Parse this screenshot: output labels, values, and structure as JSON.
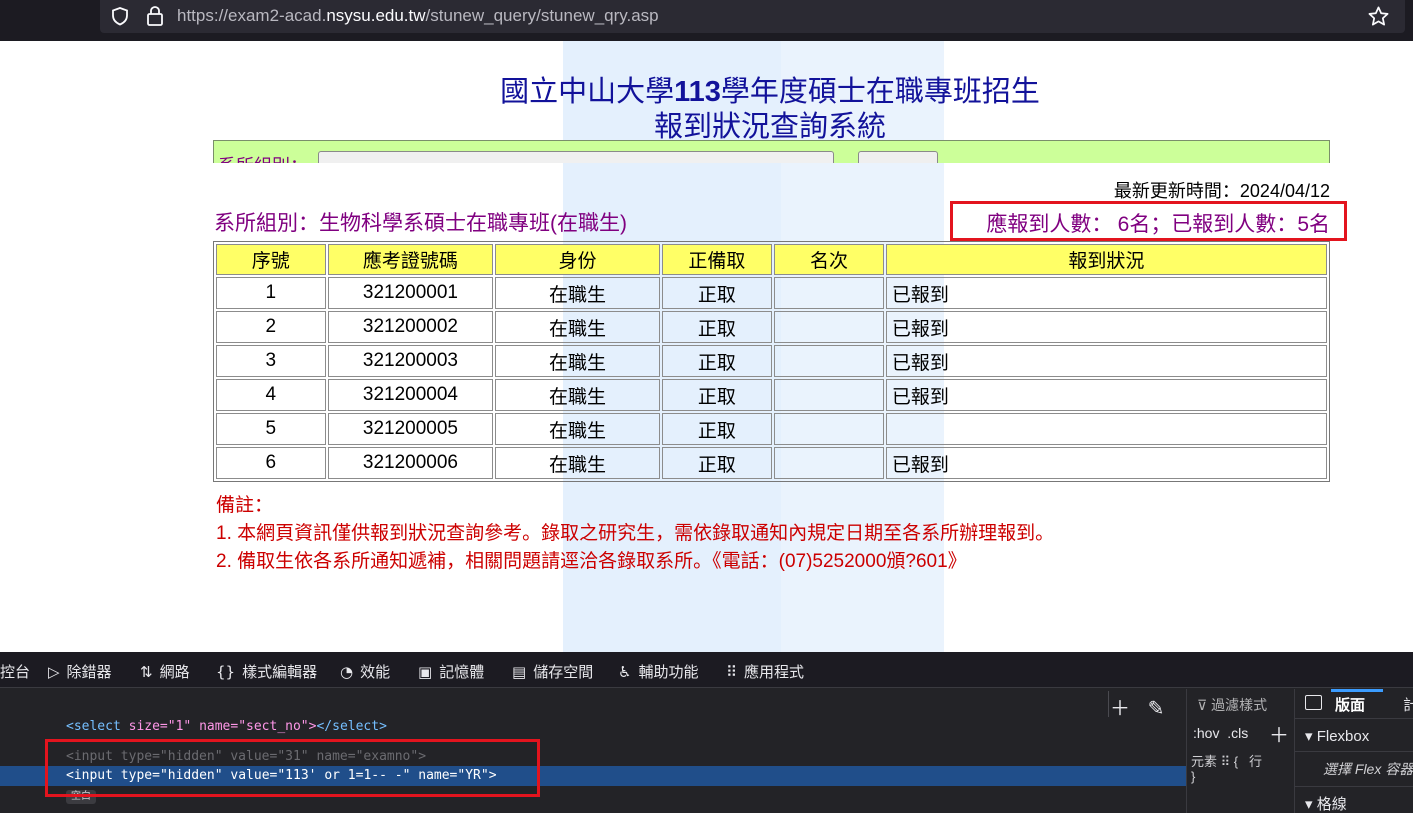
{
  "browser": {
    "url_prefix": "https://exam2-acad.",
    "url_host": "nsysu.edu.tw",
    "url_path": "/stunew_query/stunew_qry.asp"
  },
  "page": {
    "title_prefix": "國立中山大學",
    "title_year": "113",
    "title_suffix": "學年度碩士在職專班招生",
    "subtitle": "報到狀況查詢系統",
    "dept_select_label": "系所組別：",
    "last_updated_label": "最新更新時間：",
    "last_updated_value": "2024/04/12",
    "dept_label": "系所組別：",
    "dept_value": "生物科學系碩士在職專班(在職生)",
    "expected_label": "應報到人數：",
    "expected_count": "6",
    "count_unit": "名",
    "separator": "；",
    "reported_label": "已報到人數：",
    "reported_count": "5"
  },
  "table": {
    "headers": [
      "序號",
      "應考證號碼",
      "身份",
      "正備取",
      "名次",
      "報到狀況"
    ],
    "rows": [
      [
        "1",
        "321200001",
        "在職生",
        "正取",
        "",
        "已報到"
      ],
      [
        "2",
        "321200002",
        "在職生",
        "正取",
        "",
        "已報到"
      ],
      [
        "3",
        "321200003",
        "在職生",
        "正取",
        "",
        "已報到"
      ],
      [
        "4",
        "321200004",
        "在職生",
        "正取",
        "",
        "已報到"
      ],
      [
        "5",
        "321200005",
        "在職生",
        "正取",
        "",
        ""
      ],
      [
        "6",
        "321200006",
        "在職生",
        "正取",
        "",
        "已報到"
      ]
    ]
  },
  "notes": {
    "heading": "備註：",
    "items": [
      "1. 本網頁資訊僅供報到狀況查詢參考。錄取之研究生，需依錄取通知內規定日期至各系所辦理報到。",
      "2. 備取生依各系所通知遞補，相關問題請逕洽各錄取系所。《電話：(07)5252000頒?601》"
    ]
  },
  "devtools": {
    "tabs": [
      {
        "icon": "",
        "label": "控台"
      },
      {
        "icon": "▷",
        "label": "除錯器"
      },
      {
        "icon": "⇅",
        "label": "網路"
      },
      {
        "icon": "{}",
        "label": "樣式編輯器"
      },
      {
        "icon": "◔",
        "label": "效能"
      },
      {
        "icon": "▣",
        "label": "記憶體"
      },
      {
        "icon": "▤",
        "label": "儲存空間"
      },
      {
        "icon": "♿",
        "label": "輔助功能"
      },
      {
        "icon": "⠿",
        "label": "應用程式"
      }
    ],
    "html_lines": {
      "select_line_tag": "<select",
      "select_line_attrs": " size=\"1\" name=\"sect_no\">",
      "select_line_end": "</select>",
      "input1": "<input type=\"hidden\" value=\"31\" name=\"examno\">",
      "input2_tag": "<input",
      "input2_type_attr": " type=",
      "input2_type_val": "\"hidden\"",
      "input2_value_attr": " value=",
      "input2_value_val": "\"113' or 1=1-- -\"",
      "input2_name_attr": " name=",
      "input2_name_val": "\"YR\"",
      "input2_end": ">",
      "badge": "空白"
    },
    "rules": {
      "filter_placeholder": "過濾樣式",
      "hov": ":hov",
      "cls": ".cls",
      "element_label": "元素",
      "element_brace": "{",
      "inline_label": "行",
      "close_brace": "}"
    },
    "layout": {
      "tab_layout": "版面",
      "tab_computed": "計",
      "flexbox": "Flexbox",
      "flex_hint": "選擇 Flex 容器",
      "grid": "格線"
    }
  }
}
